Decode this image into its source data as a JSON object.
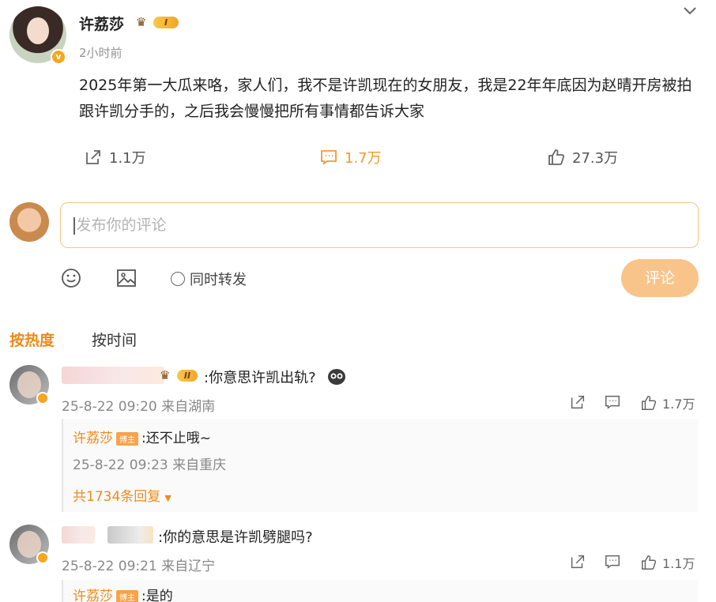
{
  "post": {
    "author": "许荔莎",
    "level": "I",
    "time": "2小时前",
    "text": "2025年第一大瓜来咯，家人们，我不是许凯现在的女朋友，我是22年年底因为赵晴开房被拍跟许凯分手的，之后我会慢慢把所有事情都告诉大家",
    "share_count": "1.1万",
    "comment_count": "1.7万",
    "like_count": "27.3万"
  },
  "composer": {
    "placeholder": "发布你的评论",
    "repost_label": "同时转发",
    "submit_label": "评论"
  },
  "tabs": {
    "hot": "按热度",
    "time": "按时间"
  },
  "comments": [
    {
      "text": ":你意思许凯出轨?",
      "level": "II",
      "meta": "25-8-22 09:20 来自湖南",
      "like_count": "1.7万",
      "reply": {
        "author": "许荔莎",
        "tag": "博主",
        "text": ":还不止哦~",
        "meta": "25-8-22 09:23 来自重庆",
        "more": "共1734条回复"
      }
    },
    {
      "text": ":你的意思是许凯劈腿吗?",
      "meta": "25-8-22 09:21 来自辽宁",
      "like_count": "1.1万",
      "reply": {
        "author": "许荔莎",
        "tag": "博主",
        "text": ":是的"
      }
    }
  ],
  "colors": {
    "accent": "#f08a1a",
    "submit_bg": "#f9c48a",
    "input_border": "#f2c784"
  },
  "icons": [
    "chevron-down-icon",
    "share-icon",
    "comment-icon",
    "like-icon",
    "emoji-icon",
    "image-icon",
    "crown-icon"
  ]
}
